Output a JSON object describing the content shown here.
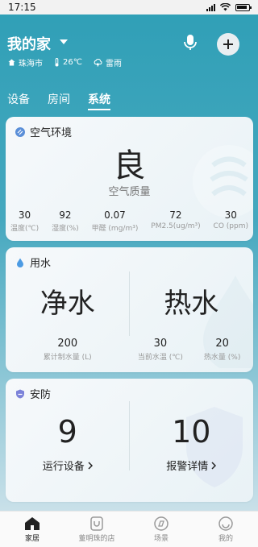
{
  "status_bar": {
    "time": "17:15"
  },
  "header": {
    "home_name": "我的家",
    "city": "珠海市",
    "temperature": "26℃",
    "weather": "雷雨"
  },
  "tabs": [
    {
      "label": "设备"
    },
    {
      "label": "房间"
    },
    {
      "label": "系统",
      "active": true
    }
  ],
  "air_card": {
    "title": "空气环境",
    "quality_value": "良",
    "quality_label": "空气质量",
    "metrics": [
      {
        "value": "30",
        "label": "温度(℃)"
      },
      {
        "value": "92",
        "label": "湿度(%)"
      },
      {
        "value": "0.07",
        "label": "甲醛 (mg/m³)"
      },
      {
        "value": "72",
        "label": "PM2.5(ug/m³)"
      },
      {
        "value": "30",
        "label": "CO (ppm)"
      }
    ]
  },
  "water_card": {
    "title": "用水",
    "pure_label": "净水",
    "hot_label": "热水",
    "metrics": [
      {
        "value": "200",
        "label": "累计制水量 (L)"
      },
      {
        "value": "30",
        "label": "当前水温 (℃)"
      },
      {
        "value": "20",
        "label": "热水量 (%)"
      }
    ]
  },
  "security_card": {
    "title": "安防",
    "running_count": "9",
    "running_label": "运行设备",
    "alarm_count": "10",
    "alarm_label": "报警详情"
  },
  "tabbar": [
    {
      "label": "家居",
      "icon": "home-icon",
      "active": true
    },
    {
      "label": "董明珠的店",
      "icon": "shop-icon"
    },
    {
      "label": "场景",
      "icon": "scene-icon"
    },
    {
      "label": "我的",
      "icon": "profile-icon"
    }
  ],
  "colors": {
    "accent": "#3ea4bb",
    "card_bg": "#f3f8fa"
  }
}
